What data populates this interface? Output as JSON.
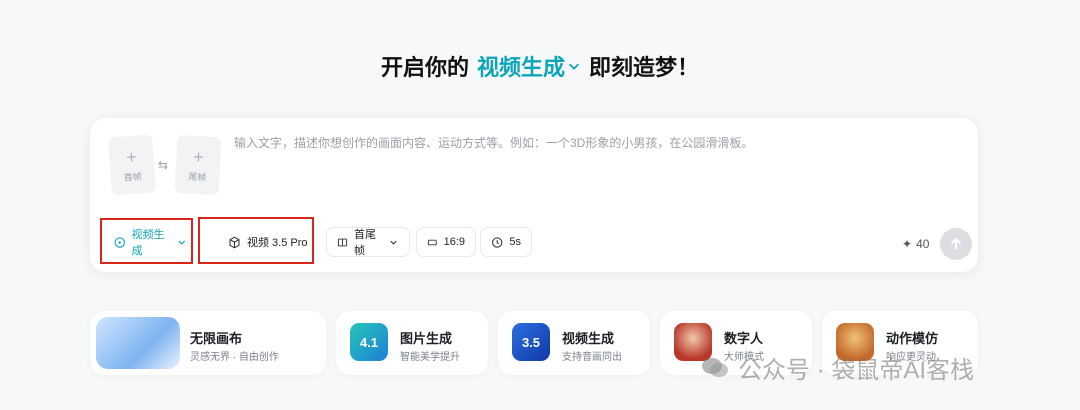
{
  "headline": {
    "prefix": "开启你的",
    "mode": "视频生成",
    "suffix": "即刻造梦！"
  },
  "composer": {
    "first_frame_label": "首帧",
    "last_frame_label": "尾帧",
    "prompt_placeholder": "输入文字，描述你想创作的画面内容、运动方式等。例如：一个3D形象的小男孩，在公园滑滑板。",
    "toolbar": {
      "mode_label": "视频生成",
      "model_label": "视频 3.5 Pro",
      "frames_label": "首尾帧",
      "ratio_label": "16:9",
      "duration_label": "5s",
      "credits": "40"
    }
  },
  "cards": [
    {
      "title": "无限画布",
      "subtitle": "灵感无界 · 自由创作"
    },
    {
      "title": "图片生成",
      "subtitle": "智能美学提升",
      "badge": "4.1"
    },
    {
      "title": "视频生成",
      "subtitle": "支持音画同出",
      "badge": "3.5"
    },
    {
      "title": "数字人",
      "subtitle": "大师模式"
    },
    {
      "title": "动作模仿",
      "subtitle": "响应更灵动"
    }
  ],
  "watermark": "公众号 · 袋鼠帝AI客栈",
  "colors": {
    "accent": "#0ba5b8",
    "highlight_box": "#d9261c"
  }
}
